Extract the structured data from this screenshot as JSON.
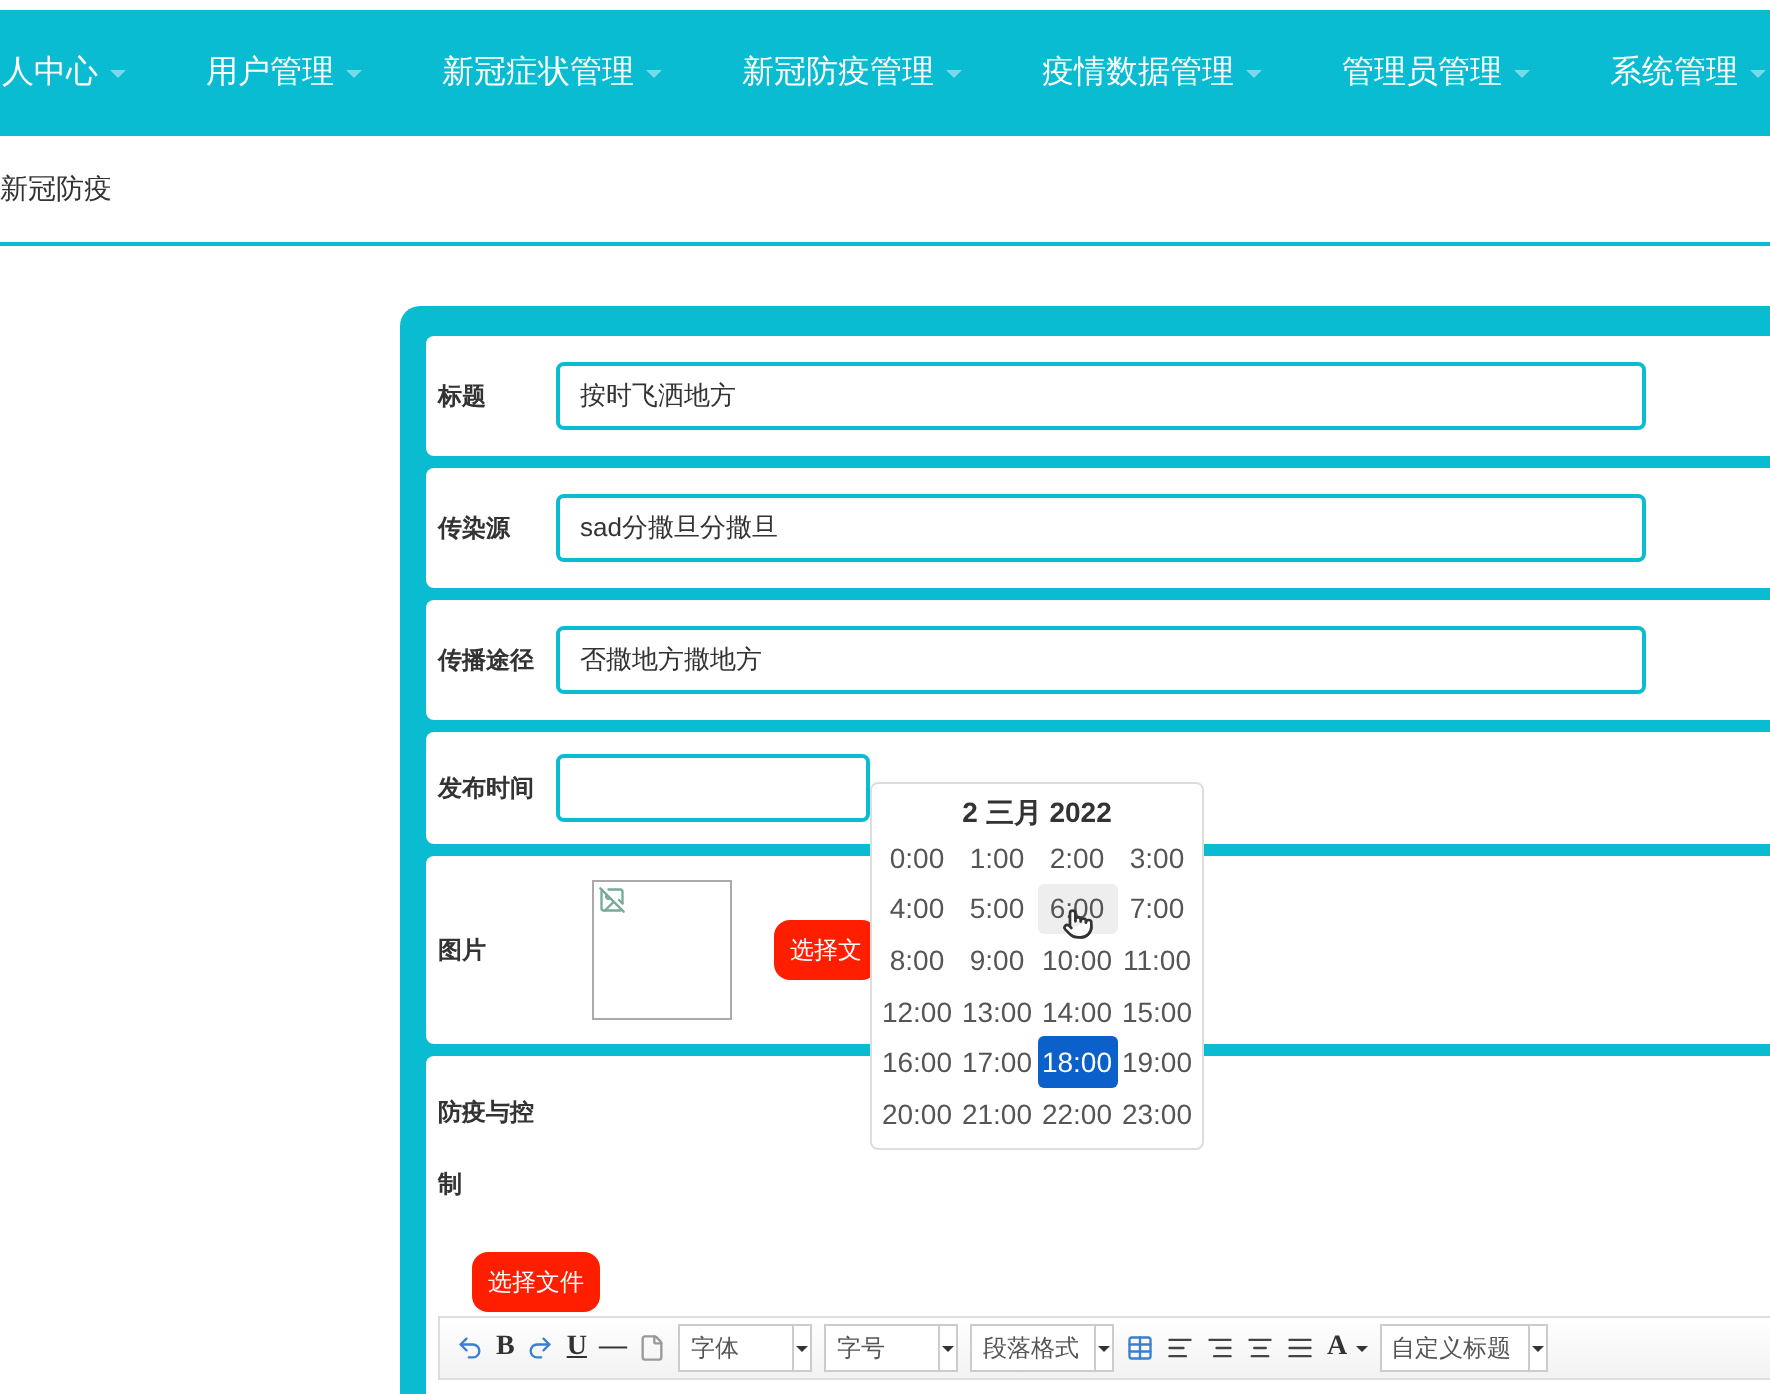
{
  "nav": [
    {
      "label": "人中心"
    },
    {
      "label": "用户管理"
    },
    {
      "label": "新冠症状管理"
    },
    {
      "label": "新冠防疫管理"
    },
    {
      "label": "疫情数据管理"
    },
    {
      "label": "管理员管理"
    },
    {
      "label": "系统管理"
    }
  ],
  "breadcrumb": "新冠防疫",
  "form": {
    "fields": [
      {
        "kind": "text",
        "label": "标题",
        "value": "按时飞洒地方"
      },
      {
        "kind": "text",
        "label": "传染源",
        "value": "sad分撒旦分撒旦"
      },
      {
        "kind": "text",
        "label": "传播途径",
        "value": "否撒地方撒地方"
      },
      {
        "kind": "date",
        "label": "发布时间"
      },
      {
        "kind": "image",
        "label": "图片",
        "button": "选择文"
      },
      {
        "kind": "editor",
        "label": "防疫与控制",
        "button": "选择文件"
      }
    ]
  },
  "datepicker": {
    "title": "2 三月 2022",
    "hours": [
      {
        "label": "0:00",
        "selected": false,
        "hovered": false
      },
      {
        "label": "1:00",
        "selected": false,
        "hovered": false
      },
      {
        "label": "2:00",
        "selected": false,
        "hovered": false
      },
      {
        "label": "3:00",
        "selected": false,
        "hovered": false
      },
      {
        "label": "4:00",
        "selected": false,
        "hovered": false
      },
      {
        "label": "5:00",
        "selected": false,
        "hovered": false
      },
      {
        "label": "6:00",
        "selected": false,
        "hovered": true
      },
      {
        "label": "7:00",
        "selected": false,
        "hovered": false
      },
      {
        "label": "8:00",
        "selected": false,
        "hovered": false
      },
      {
        "label": "9:00",
        "selected": false,
        "hovered": false
      },
      {
        "label": "10:00",
        "selected": false,
        "hovered": false
      },
      {
        "label": "11:00",
        "selected": false,
        "hovered": false
      },
      {
        "label": "12:00",
        "selected": false,
        "hovered": false
      },
      {
        "label": "13:00",
        "selected": false,
        "hovered": false
      },
      {
        "label": "14:00",
        "selected": false,
        "hovered": false
      },
      {
        "label": "15:00",
        "selected": false,
        "hovered": false
      },
      {
        "label": "16:00",
        "selected": false,
        "hovered": false
      },
      {
        "label": "17:00",
        "selected": false,
        "hovered": false
      },
      {
        "label": "18:00",
        "selected": true,
        "hovered": false
      },
      {
        "label": "19:00",
        "selected": false,
        "hovered": false
      },
      {
        "label": "20:00",
        "selected": false,
        "hovered": false
      },
      {
        "label": "21:00",
        "selected": false,
        "hovered": false
      },
      {
        "label": "22:00",
        "selected": false,
        "hovered": false
      },
      {
        "label": "23:00",
        "selected": false,
        "hovered": false
      }
    ]
  },
  "editor_toolbar": [
    {
      "kind": "undo"
    },
    {
      "kind": "char",
      "text": "B"
    },
    {
      "kind": "redo"
    },
    {
      "kind": "char",
      "text": "U",
      "underline": true
    },
    {
      "kind": "char",
      "text": "—"
    },
    {
      "kind": "page"
    },
    {
      "kind": "select",
      "text": "字体"
    },
    {
      "kind": "select",
      "text": "字号"
    },
    {
      "kind": "select",
      "text": "段落格式"
    },
    {
      "kind": "table"
    },
    {
      "kind": "align-left"
    },
    {
      "kind": "align-right"
    },
    {
      "kind": "align-center"
    },
    {
      "kind": "align-justify"
    },
    {
      "kind": "color",
      "text": "A"
    },
    {
      "kind": "select",
      "text": "自定义标题"
    }
  ]
}
